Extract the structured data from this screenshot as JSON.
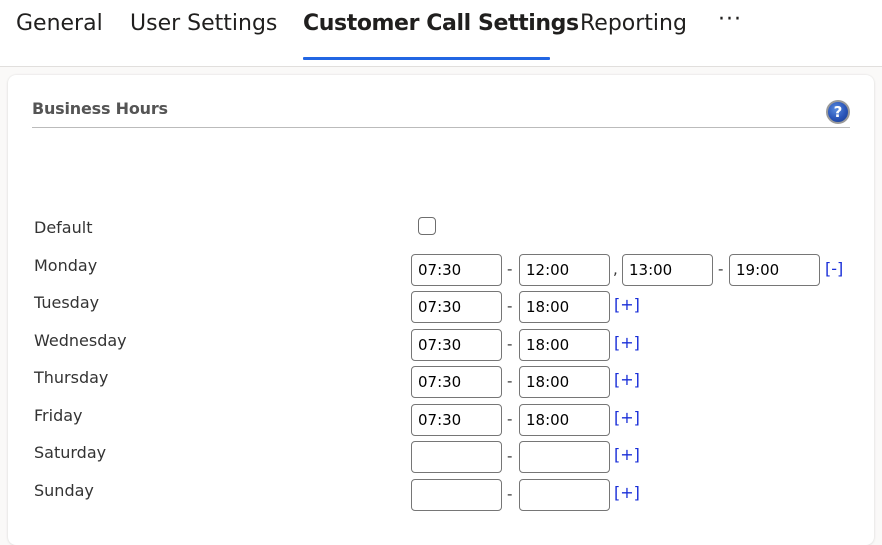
{
  "tabs": [
    {
      "label": "General",
      "active": false
    },
    {
      "label": "User Settings",
      "active": false
    },
    {
      "label": "Customer Call Settings",
      "active": true
    },
    {
      "label": "Reporting",
      "active": false
    }
  ],
  "more_tabs_label": "···",
  "colors": {
    "active_tab_underline": "#2266e3",
    "link": "#1a2fd8",
    "help_icon": "#2a55b8"
  },
  "section": {
    "title": "Business Hours",
    "help_icon": "help-icon",
    "help_glyph": "?"
  },
  "default_row": {
    "label": "Default",
    "checked": false
  },
  "days": [
    {
      "label": "Monday",
      "ranges": [
        {
          "start": "07:30",
          "end": "12:00"
        },
        {
          "start": "13:00",
          "end": "19:00"
        }
      ],
      "toggle": "[-]"
    },
    {
      "label": "Tuesday",
      "ranges": [
        {
          "start": "07:30",
          "end": "18:00"
        }
      ],
      "toggle": "[+]"
    },
    {
      "label": "Wednesday",
      "ranges": [
        {
          "start": "07:30",
          "end": "18:00"
        }
      ],
      "toggle": "[+]"
    },
    {
      "label": "Thursday",
      "ranges": [
        {
          "start": "07:30",
          "end": "18:00"
        }
      ],
      "toggle": "[+]"
    },
    {
      "label": "Friday",
      "ranges": [
        {
          "start": "07:30",
          "end": "18:00"
        }
      ],
      "toggle": "[+]"
    },
    {
      "label": "Saturday",
      "ranges": [
        {
          "start": "",
          "end": ""
        }
      ],
      "toggle": "[+]"
    },
    {
      "label": "Sunday",
      "ranges": [
        {
          "start": "",
          "end": ""
        }
      ],
      "toggle": "[+]"
    }
  ],
  "range_separator": "-",
  "ranges_separator": ","
}
